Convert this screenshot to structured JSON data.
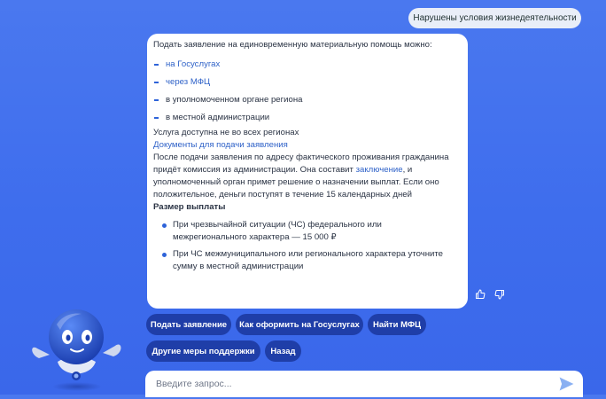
{
  "user_message": "Нарушены условия жизнедеятельности",
  "bot": {
    "intro": "Подать заявление на единовременную материальную помощь можно:",
    "options": [
      {
        "text": "на Госуслугах",
        "is_link": true
      },
      {
        "text": "через МФЦ",
        "is_link": true
      },
      {
        "text": "в уполномоченном органе региона",
        "is_link": false
      },
      {
        "text": "в местной администрации",
        "is_link": false
      }
    ],
    "availability": "Услуга доступна не во всех регионах",
    "docs_link": "Документы для подачи заявления",
    "after_part1": "После подачи заявления по адресу фактического проживания гражданина придёт комиссия из администрации. Она составит ",
    "after_link": "заключение",
    "after_part2": ", и уполномоченный орган примет решение о назначении выплат. Если оно положительное, деньги поступят в течение 15 календарных дней",
    "payment_heading": "Размер выплаты",
    "payments": [
      "При чрезвычайной ситуации (ЧС) федерального или межрегионального характера — 15 000 ₽",
      "При ЧС межмуниципального или регионального характера уточните сумму в местной администрации"
    ]
  },
  "chips": [
    "Подать заявление",
    "Как оформить на Госуслугах",
    "Найти МФЦ",
    "Другие меры поддержки",
    "Назад"
  ],
  "input": {
    "placeholder": "Введите запрос..."
  },
  "icons": {
    "like": "thumbs-up-icon",
    "dislike": "thumbs-down-icon",
    "send": "send-arrow-icon",
    "mascot": "robot-mascot"
  },
  "colors": {
    "background": "#3e6ded",
    "chip": "#1f3ea8",
    "link": "#2f62c8",
    "accent": "#2e63d9"
  }
}
